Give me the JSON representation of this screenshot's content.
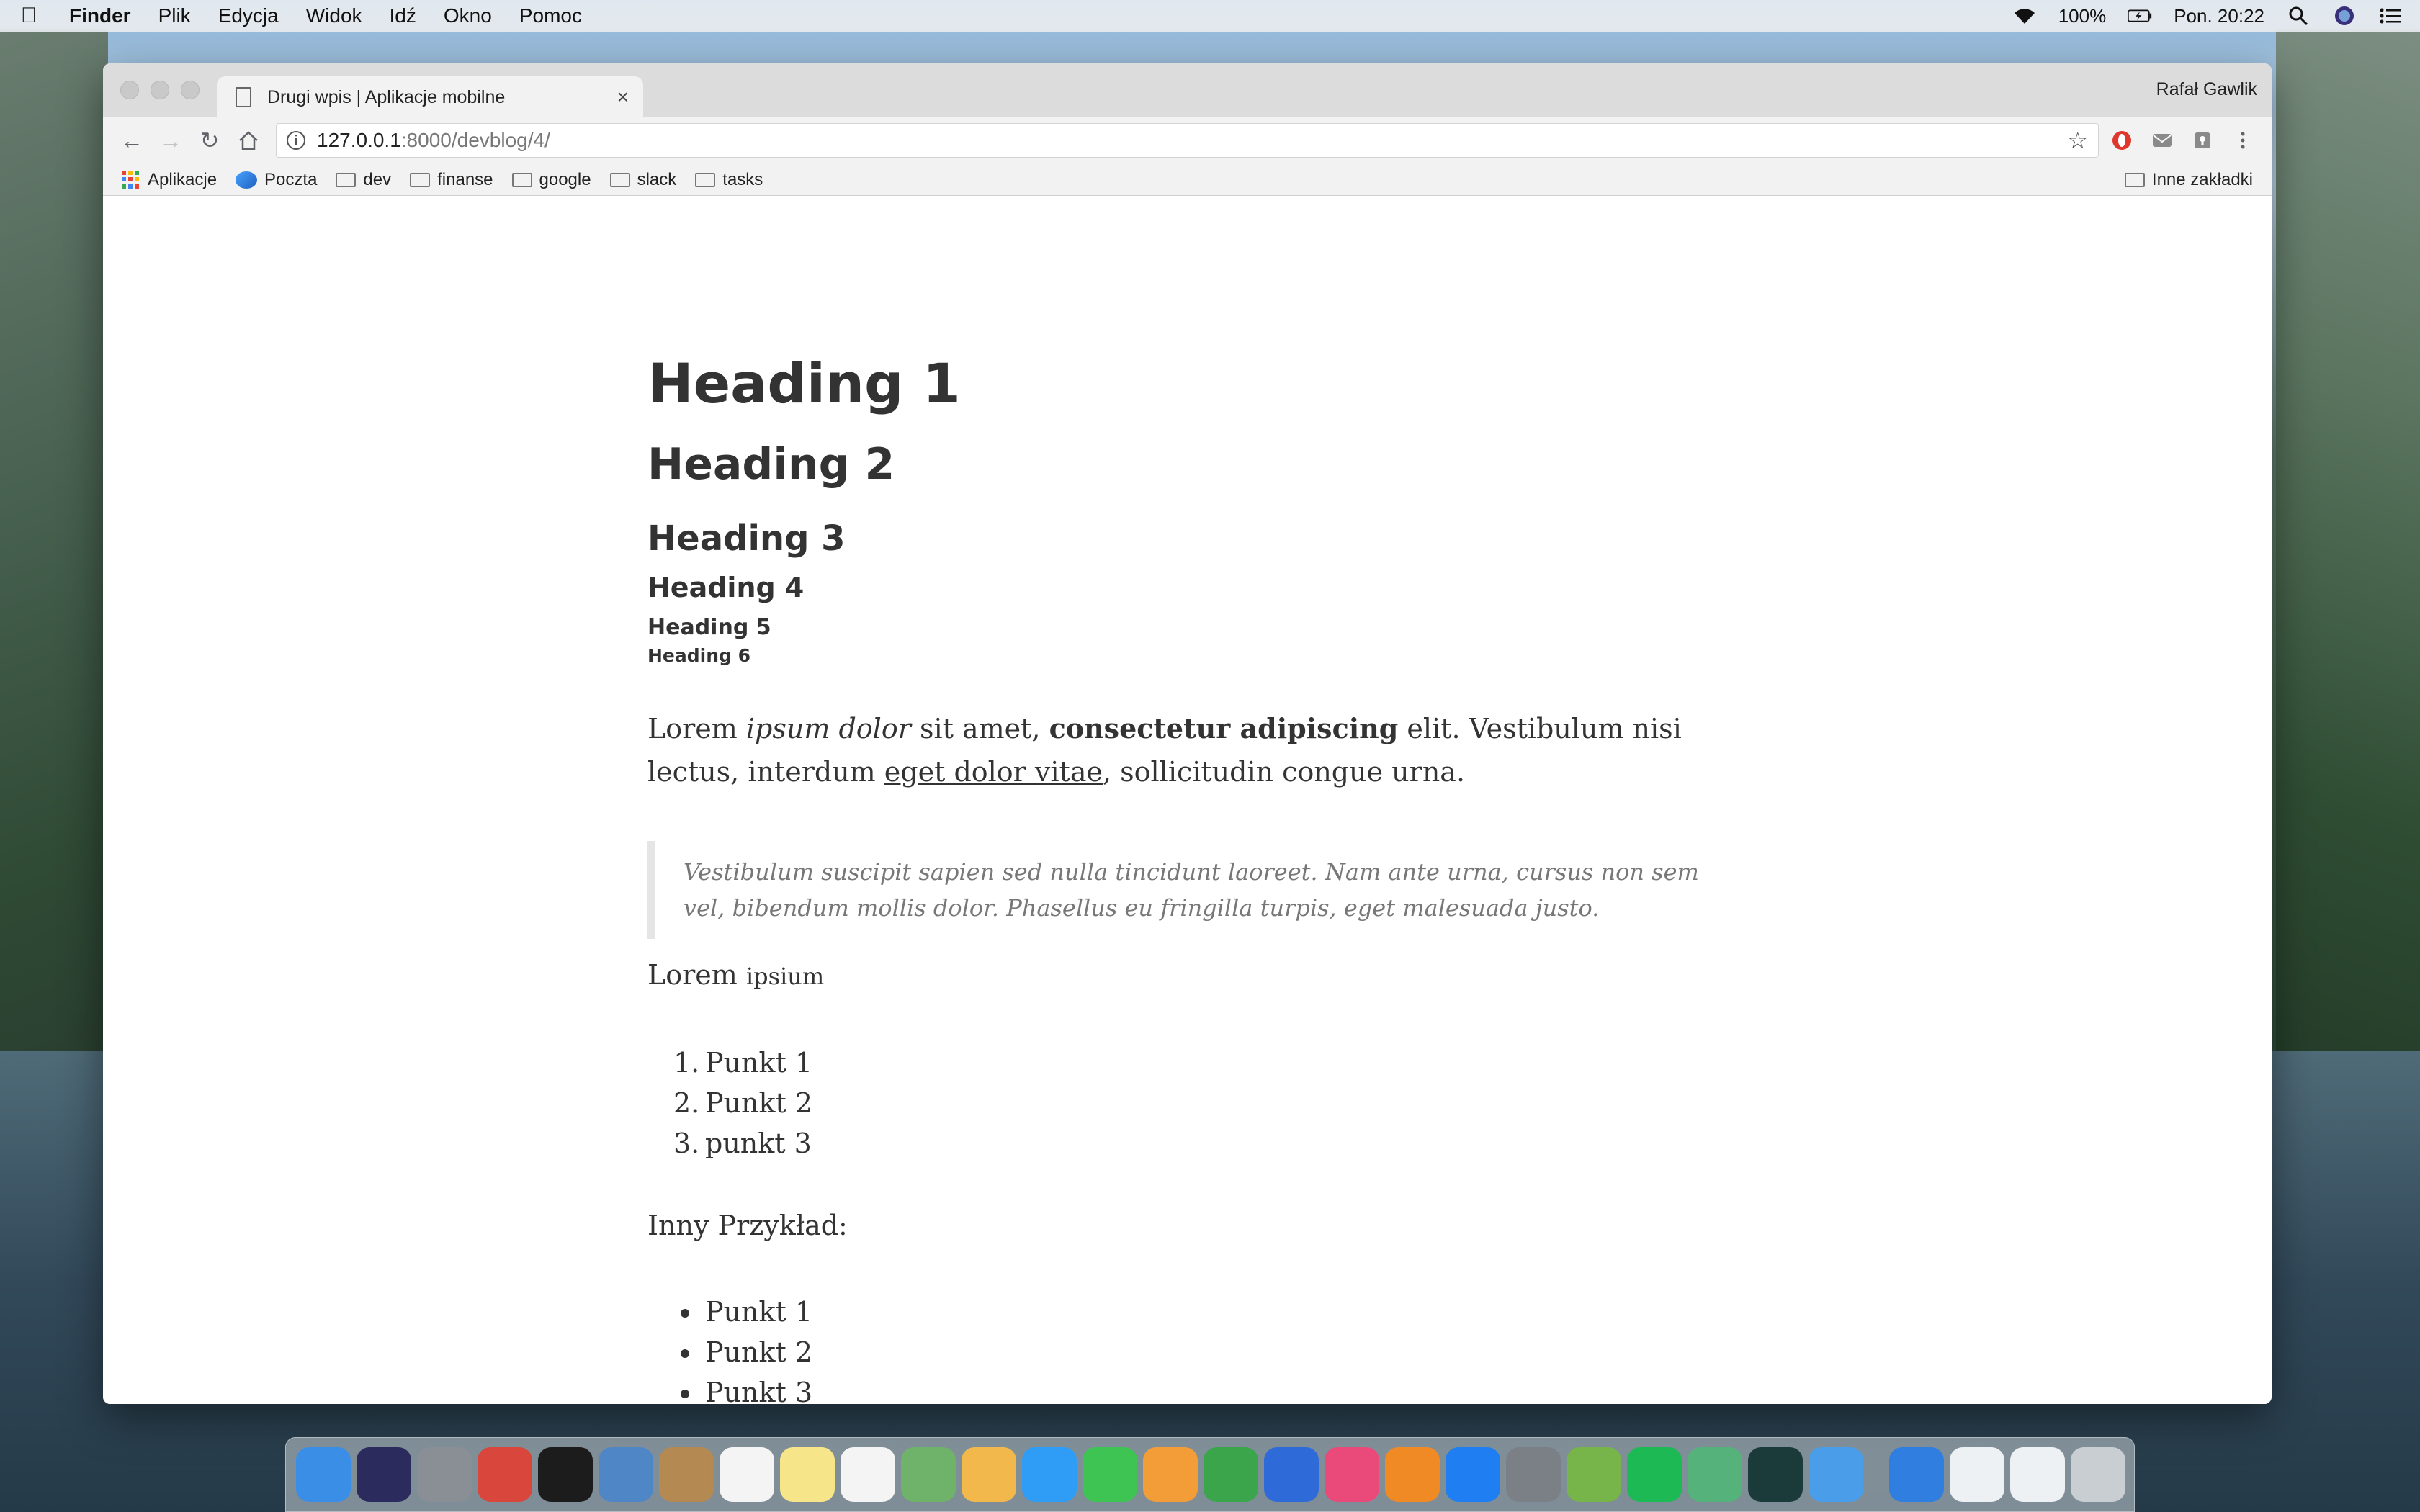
{
  "menubar": {
    "app": "Finder",
    "items": [
      "Plik",
      "Edycja",
      "Widok",
      "Idź",
      "Okno",
      "Pomoc"
    ],
    "battery": "100%",
    "clock": "Pon. 20:22"
  },
  "browser": {
    "tab_title": "Drugi wpis | Aplikacje mobilne",
    "profile": "Rafał Gawlik",
    "url_host": "127.0.0.1",
    "url_path": ":8000/devblog/4/",
    "bookmarks": [
      "Aplikacje",
      "Poczta",
      "dev",
      "finanse",
      "google",
      "slack",
      "tasks"
    ],
    "other_bookmarks": "Inne zakładki"
  },
  "article": {
    "h1": "Heading 1",
    "h2": "Heading 2",
    "h3": "Heading 3",
    "h4": "Heading 4",
    "h5": "Heading 5",
    "h6": "Heading 6",
    "p1": {
      "t1": "Lorem ",
      "em": "ipsum dolor",
      "t2": " sit amet, ",
      "strong": "consectetur adipiscing",
      "t3": " elit. Vestibulum nisi lectus, interdum ",
      "link": "eget dolor vitae",
      "t4": ", sollicitudin congue urna."
    },
    "quote": "Vestibulum suscipit sapien sed nulla tincidunt laoreet. Nam ante urna, cursus non sem vel, bibendum mollis dolor. Phasellus eu fringilla turpis, eget malesuada justo.",
    "p2_main": "Lorem",
    "p2_small": "ipsium",
    "ordered": [
      "Punkt 1",
      "Punkt 2",
      "punkt 3"
    ],
    "p3": "Inny Przykład:",
    "unordered": [
      "Punkt 1",
      "Punkt 2",
      "Punkt 3"
    ]
  },
  "dock": {
    "apps": [
      {
        "icon": "finder-icon",
        "color": "#3a8ee6"
      },
      {
        "icon": "siri-icon",
        "color": "#2b2b5e"
      },
      {
        "icon": "launchpad-icon",
        "color": "#8a8f96"
      },
      {
        "icon": "chrome-icon",
        "color": "#d9463b"
      },
      {
        "icon": "terminal-icon",
        "color": "#1c1c1c"
      },
      {
        "icon": "preview-icon",
        "color": "#4f86c6"
      },
      {
        "icon": "contacts-icon",
        "color": "#b58a52"
      },
      {
        "icon": "calendar-icon",
        "color": "#f4f4f4"
      },
      {
        "icon": "notes-icon",
        "color": "#f7e58a"
      },
      {
        "icon": "reminders-icon",
        "color": "#f4f4f4"
      },
      {
        "icon": "maps-icon",
        "color": "#6fb36b"
      },
      {
        "icon": "photos-icon",
        "color": "#f2b84b"
      },
      {
        "icon": "messages-icon",
        "color": "#2f9cf5"
      },
      {
        "icon": "facetime-icon",
        "color": "#3ec453"
      },
      {
        "icon": "pages-icon",
        "color": "#f29d38"
      },
      {
        "icon": "numbers-icon",
        "color": "#3aa54b"
      },
      {
        "icon": "keynote-icon",
        "color": "#2e6ad8"
      },
      {
        "icon": "itunes-icon",
        "color": "#e94a79"
      },
      {
        "icon": "ibooks-icon",
        "color": "#f08a25"
      },
      {
        "icon": "appstore-icon",
        "color": "#1f7ff2"
      },
      {
        "icon": "system-preferences-icon",
        "color": "#7b7f86"
      },
      {
        "icon": "android-studio-icon",
        "color": "#77b54a"
      },
      {
        "icon": "spotify-icon",
        "color": "#1db954"
      },
      {
        "icon": "atom-icon",
        "color": "#55b27a"
      },
      {
        "icon": "gitkraken-icon",
        "color": "#1a3b3a"
      },
      {
        "icon": "xcode-icon",
        "color": "#4a9de8"
      },
      {
        "icon": "sourcetree-icon",
        "color": "#2f7ee0"
      }
    ]
  }
}
